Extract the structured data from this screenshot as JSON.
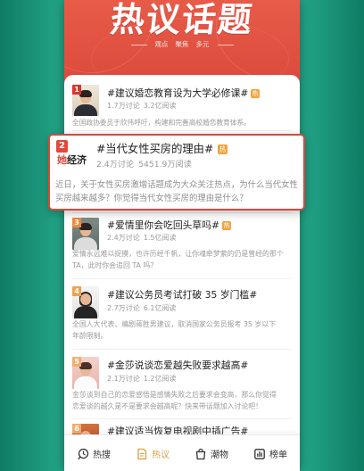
{
  "header": {
    "title": "热议话题",
    "subtitle": [
      "观点",
      "聚焦",
      "多元"
    ]
  },
  "topics": [
    {
      "rank": "1",
      "title": "#建议婚恋教育设为大学必修课#",
      "badge": "热",
      "discussions": "1.7万讨论",
      "reads": "3.2亿阅读",
      "desc_lines": [
        "全国政协委员于欣伟呼吁，构建和完善高校婚恋教育体系。"
      ]
    },
    {
      "rank": "2",
      "logo": {
        "accent": "她",
        "rest": "经济"
      },
      "title": "#当代女性买房的理由#",
      "badge": "热",
      "discussions": "2.4万讨论",
      "reads": "5451.9万阅读",
      "desc_lines": [
        "近日，关于女性买房激增话题成为大众关注热点，为什么当代女性",
        "买房越来越多？你觉得当代女性买房的理由是什么？"
      ],
      "highlighted": true
    },
    {
      "rank": "3",
      "title": "#爱情里你会吃回头草吗#",
      "badge": "热",
      "discussions": "2.4万讨论",
      "reads": "1.5亿阅读",
      "desc_lines": [
        "爱情永远难以捉摸，也许历经千帆，让你魂牵梦萦的仍是曾经的那个",
        "TA，此时你会追回 TA 吗？"
      ]
    },
    {
      "rank": "4",
      "title": "#建议公务员考试打破 35 岁门槛#",
      "discussions": "2.7万讨论",
      "reads": "6.1亿阅读",
      "desc_lines": [
        "全国人大代表、编剧蒋胜男建议，取消国家公务员报考 35 岁以下",
        "年龄限制。"
      ]
    },
    {
      "rank": "5",
      "title": "#金莎说谈恋爱越失败要求越高#",
      "discussions": "2.1万讨论",
      "reads": "1.2亿阅读",
      "desc_lines": [
        "金莎谈到自己的恋爱感悟是感情失败之后要求会变高，那么你觉得",
        "恋爱谈的越久是不是要求会越高呢？快来带话题加入讨论吧！"
      ]
    },
    {
      "rank": "6",
      "title": "#建议适当恢复电视剧中插广告#"
    }
  ],
  "tabs": [
    {
      "label": "热搜",
      "icon": "hot-search-icon"
    },
    {
      "label": "热议",
      "icon": "hot-discussion-icon",
      "active": true
    },
    {
      "label": "潮物",
      "icon": "shopping-bag-icon"
    },
    {
      "label": "榜单",
      "icon": "ranking-list-icon"
    }
  ],
  "colors": {
    "page_bg": "#1f9c80",
    "header_top": "#e85b48",
    "header_bottom": "#db4a3c",
    "highlight_border": "#d8483b",
    "hot_badge": "#f2a23b",
    "active_tab": "#d9a04a",
    "title_text": "#222222",
    "meta_text": "#999999",
    "rank_1": "#d9362b",
    "rank_2": "#e2483a",
    "rank_3": "#ef8a3f",
    "rank_4": "#f0a14c",
    "rank_5": "#f2ae6e",
    "rank_6": "#f2ae6e"
  }
}
